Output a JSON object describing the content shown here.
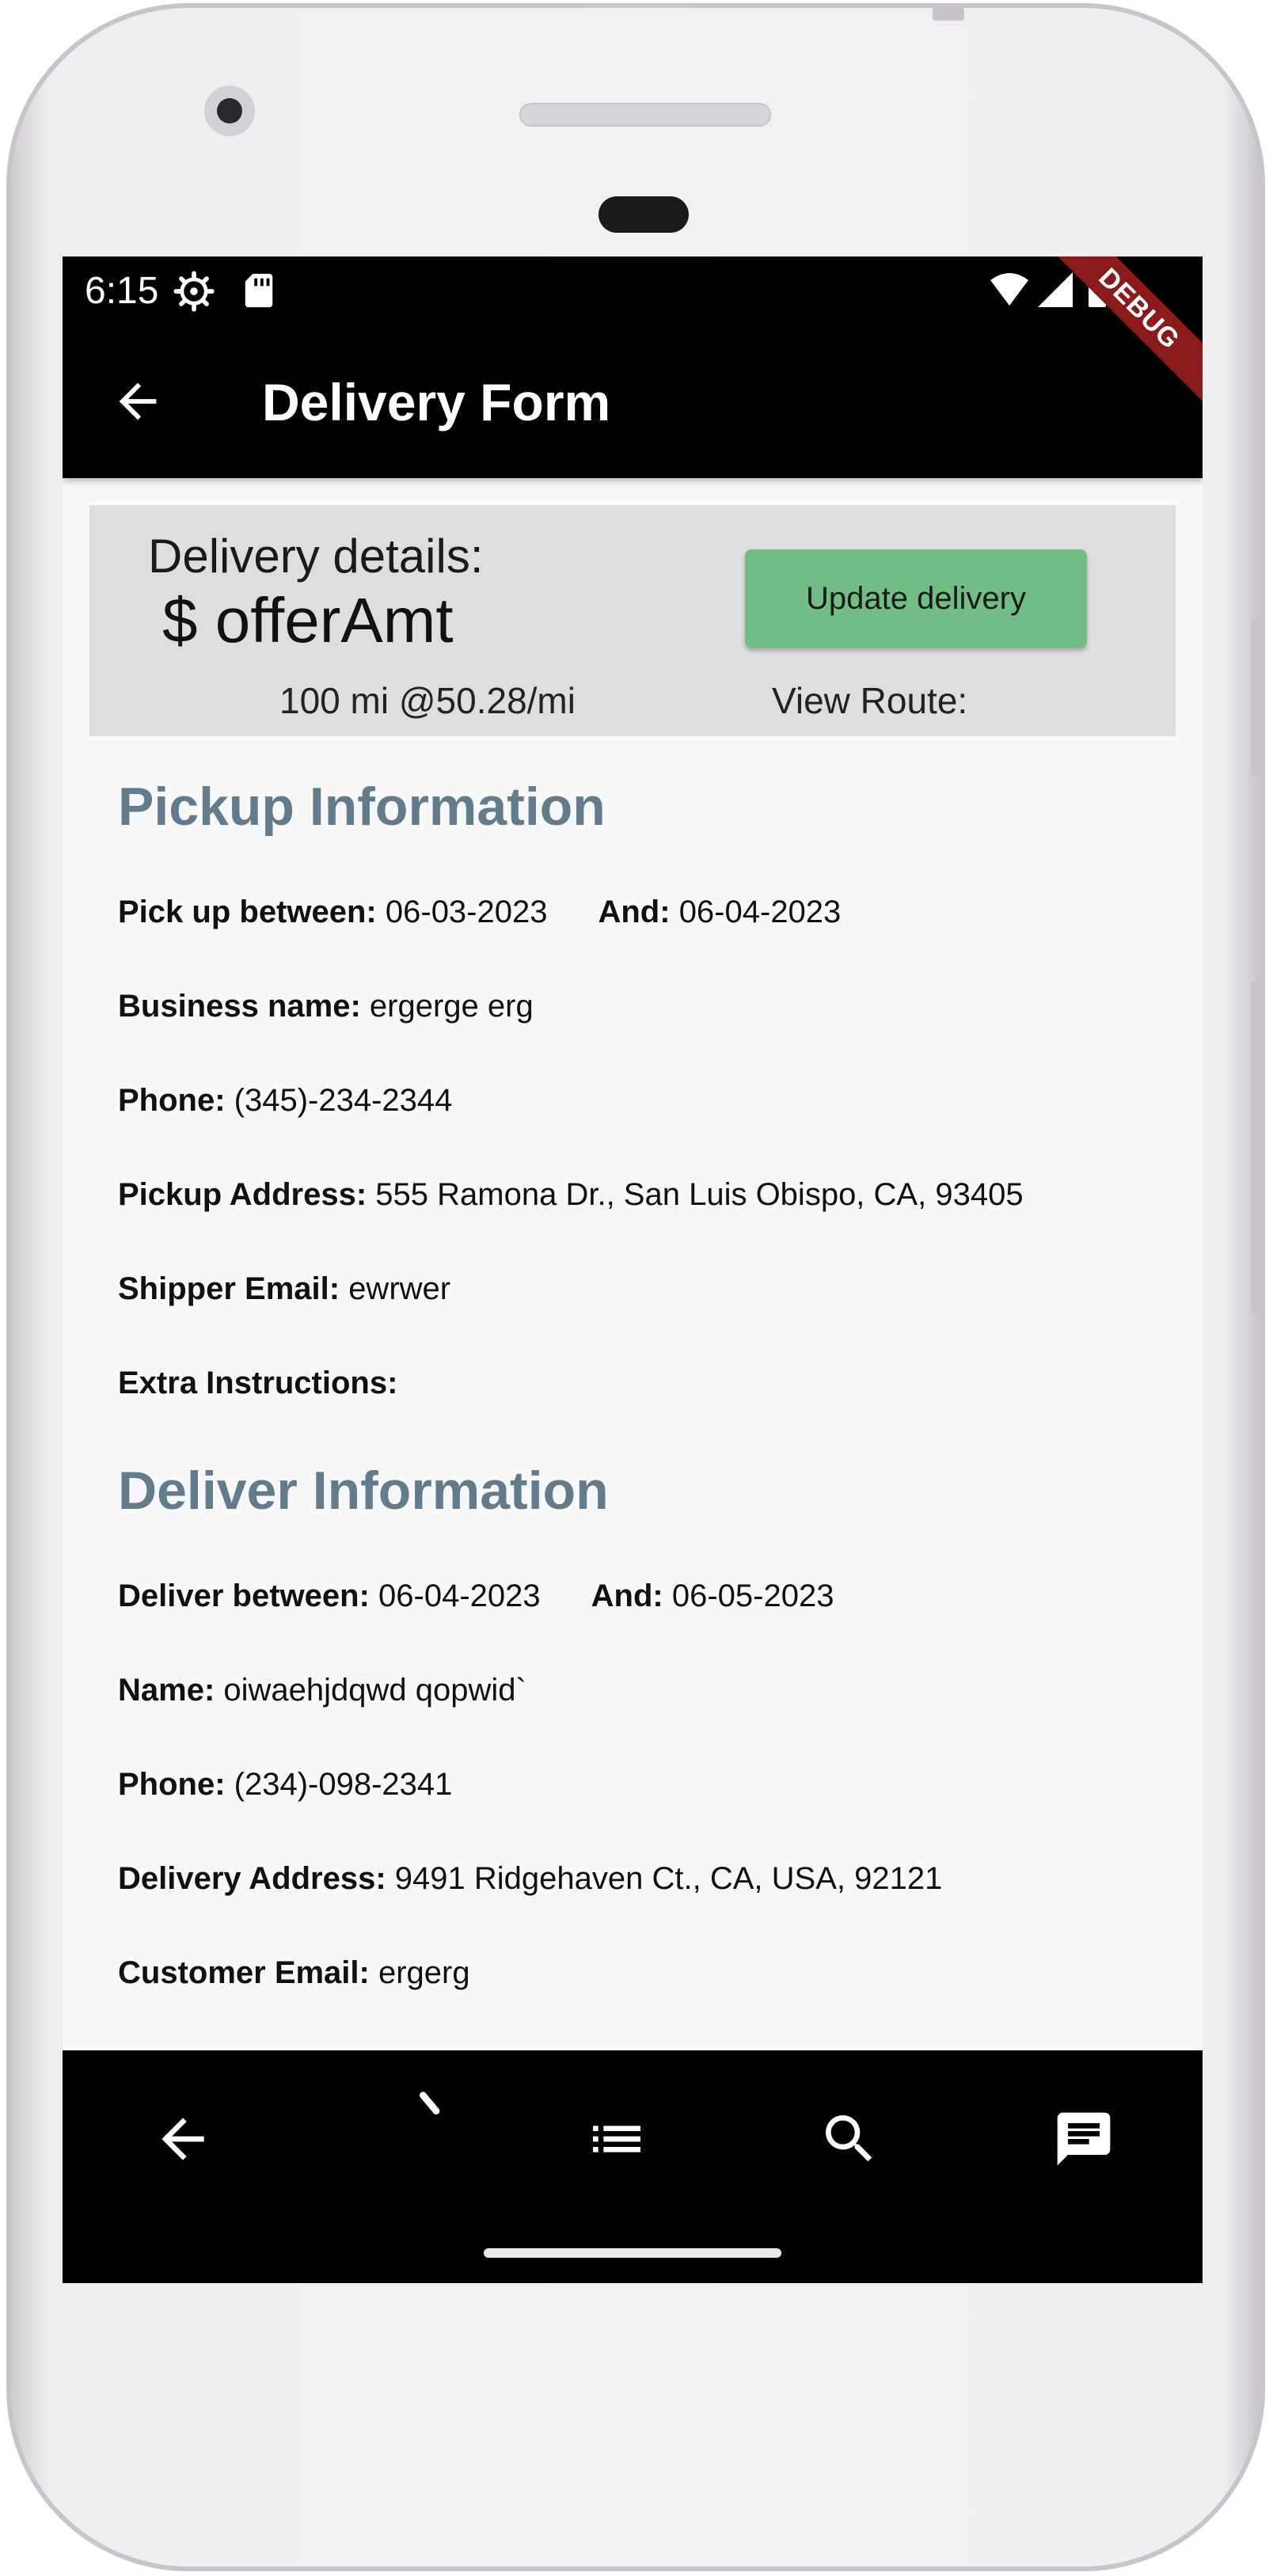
{
  "status_bar": {
    "time": "6:15",
    "icons": [
      "gear-icon",
      "sd-card-icon",
      "wifi-icon",
      "signal-icon",
      "battery-icon"
    ]
  },
  "app_bar": {
    "title": "Delivery Form",
    "debug_label": "DEBUG"
  },
  "summary": {
    "title": "Delivery details:",
    "amount": "$ offerAmt",
    "rate": "100 mi @50.28/mi",
    "update_button": "Update delivery",
    "view_route": "View Route:"
  },
  "pickup": {
    "heading": "Pickup Information",
    "between_label": "Pick up between:",
    "between_value": "06-03-2023",
    "and_label": "And:",
    "and_value": "06-04-2023",
    "business_label": "Business name:",
    "business_value": "ergerge erg",
    "phone_label": "Phone:",
    "phone_value": "(345)-234-2344",
    "address_label": "Pickup Address:",
    "address_value": "555 Ramona Dr., San Luis Obispo, CA, 93405",
    "email_label": "Shipper Email:",
    "email_value": "ewrwer",
    "instructions_label": "Extra Instructions:",
    "instructions_value": ""
  },
  "deliver": {
    "heading": "Deliver Information",
    "between_label": "Deliver between:",
    "between_value": "06-04-2023",
    "and_label": "And:",
    "and_value": "06-05-2023",
    "name_label": "Name:",
    "name_value": "oiwaehjdqwd qopwid`",
    "phone_label": "Phone:",
    "phone_value": "(234)-098-2341",
    "address_label": "Delivery Address:",
    "address_value": "9491 Ridgehaven Ct., CA, USA, 92121",
    "email_label": "Customer Email:",
    "email_value": "ergerg"
  },
  "bottom_nav": {
    "items": [
      "back-arrow-icon",
      "loading-icon",
      "list-icon",
      "search-icon",
      "message-icon"
    ]
  },
  "colors": {
    "section_heading": "#627c8c",
    "button": "#72bd85",
    "debug_banner": "#8b1a1a"
  }
}
